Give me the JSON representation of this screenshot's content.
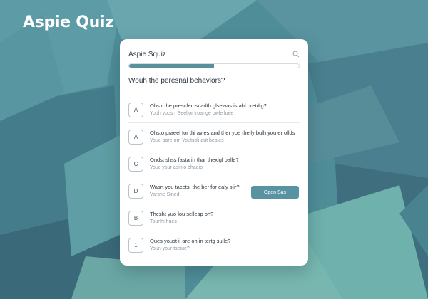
{
  "app": {
    "title": "Aspie Quiz"
  },
  "colors": {
    "background": "#4e8d98",
    "accent": "#5993a3",
    "progress_fill": "#5a8f9c",
    "card": "#ffffff"
  },
  "card": {
    "title": "Aspie Squiz",
    "search_icon": "search-icon",
    "progress": 0.5,
    "question": "Wouh the peresnal behaviors?"
  },
  "options": [
    {
      "letter": "A",
      "text": "Ohstr the prescfercscadth glsewas is ahl bretdig?",
      "sub": "Youh yous r Seeljor lroange owle loee"
    },
    {
      "letter": "A",
      "text": "Ohsto praeel for thi avies and ther yoe theily bulh you er ollds",
      "sub": "Youe bare om Youtsoli aut beales"
    },
    {
      "letter": "C",
      "text": "Ondst shss fasta in thar thexigl balle?",
      "sub": "Youc your asinlo bhaeio"
    },
    {
      "letter": "D",
      "text": "Wasrt you tacets, the ber for ealy slir?",
      "sub": "Varshe Sined",
      "button": "Open Sas"
    },
    {
      "letter": "B",
      "text": "Thesht yuo lou sellesp oh?",
      "sub": "Tounhi hues"
    },
    {
      "letter": "1",
      "text": "Ques youst il are oh in tertg sulle?",
      "sub": "Youn your tseiue?"
    }
  ]
}
